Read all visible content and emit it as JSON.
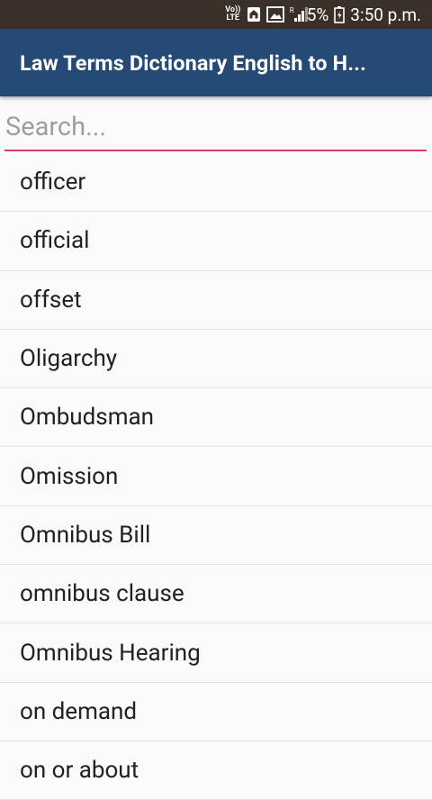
{
  "status_bar": {
    "volte_top": "Vo))",
    "volte_bottom": "LTE",
    "signal_label": "R",
    "battery_percent": "5%",
    "time": "3:50 p.m."
  },
  "app_bar": {
    "title": "Law Terms Dictionary English to H..."
  },
  "search": {
    "placeholder": "Search..."
  },
  "terms": [
    "officer",
    "official",
    "offset",
    "Oligarchy",
    "Ombudsman",
    "Omission",
    "Omnibus Bill",
    "omnibus clause",
    "Omnibus Hearing",
    "on demand",
    "on or about"
  ],
  "colors": {
    "status_bar": "#3a3028",
    "app_bar": "#254a75",
    "search_underline": "#e0397b",
    "background": "#fafafa"
  }
}
